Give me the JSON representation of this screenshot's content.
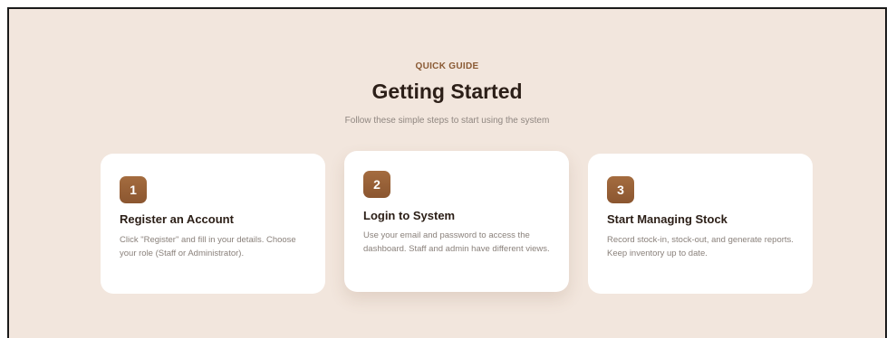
{
  "header": {
    "eyebrow": "QUICK GUIDE",
    "title": "Getting Started",
    "subtitle": "Follow these simple steps to start using the system"
  },
  "steps": [
    {
      "number": "1",
      "title": "Register an Account",
      "text": "Click \"Register\" and fill in your details. Choose your role (Staff or Administrator)."
    },
    {
      "number": "2",
      "title": "Login to System",
      "text": "Use your email and password to access the dashboard. Staff and admin have different views."
    },
    {
      "number": "3",
      "title": "Start Managing Stock",
      "text": "Record stock-in, stock-out, and generate reports. Keep inventory up to date."
    }
  ],
  "colors": {
    "background": "#f2e6dd",
    "accent": "#9a6338",
    "card": "#ffffff",
    "heading": "#2c1f18",
    "muted_text": "#8f8680"
  }
}
